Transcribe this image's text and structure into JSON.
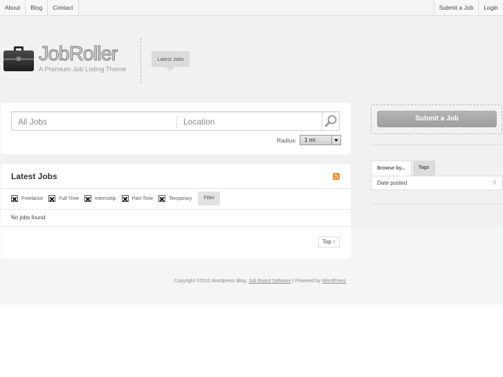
{
  "nav": {
    "left": [
      "About",
      "Blog",
      "Contact"
    ],
    "right": [
      "Submit a Job",
      "Login"
    ]
  },
  "header": {
    "logo_title": "JobRoller",
    "logo_tagline": "A Premium Job Listing Theme",
    "latest_tab": "Latest Jobs"
  },
  "search": {
    "keyword_placeholder": "All Jobs",
    "location_placeholder": "Location",
    "radius_label": "Radius:",
    "radius_value": "1 mi"
  },
  "jobs": {
    "title": "Latest Jobs",
    "filters": [
      "Freelance",
      "Full-Time",
      "Internship",
      "Part-Time",
      "Temporary"
    ],
    "filter_button": "Filter",
    "empty_message": "No jobs found.",
    "top_button": "Top ↑"
  },
  "footer": {
    "copyright": "Copyright ©2011 Wordpress Blog.",
    "link1": "Job Board Software",
    "powered": "| Powered by",
    "link2": "WordPress"
  },
  "sidebar": {
    "submit_button": "Submit a Job",
    "tabs": [
      "Browse by...",
      "Tags"
    ],
    "browse_item": "Date posted"
  },
  "colors": {
    "background": "#f1f1f1",
    "panel": "#ffffff",
    "submit_button": "#a9a9a9",
    "rss": "#f48a2c"
  }
}
